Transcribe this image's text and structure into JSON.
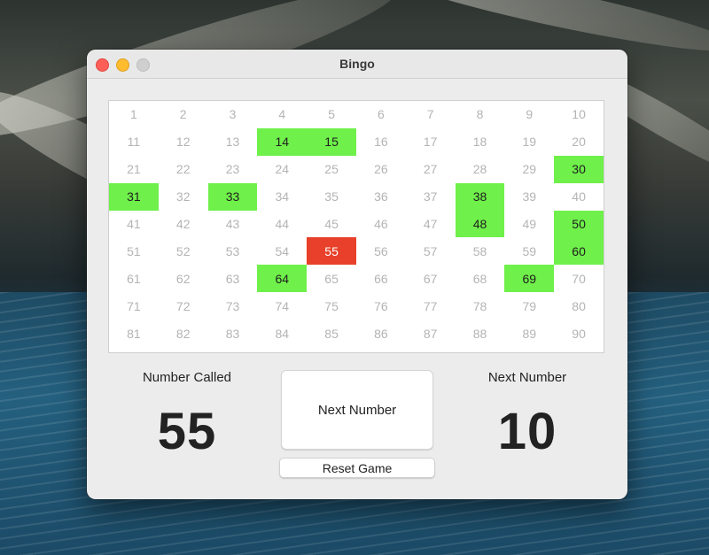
{
  "window": {
    "title": "Bingo"
  },
  "colors": {
    "called": "#6ff04a",
    "current": "#e8402a",
    "uncalled_text": "#b4b4b4"
  },
  "board": {
    "numbers": [
      1,
      2,
      3,
      4,
      5,
      6,
      7,
      8,
      9,
      10,
      11,
      12,
      13,
      14,
      15,
      16,
      17,
      18,
      19,
      20,
      21,
      22,
      23,
      24,
      25,
      26,
      27,
      28,
      29,
      30,
      31,
      32,
      33,
      34,
      35,
      36,
      37,
      38,
      39,
      40,
      41,
      42,
      43,
      44,
      45,
      46,
      47,
      48,
      49,
      50,
      51,
      52,
      53,
      54,
      55,
      56,
      57,
      58,
      59,
      60,
      61,
      62,
      63,
      64,
      65,
      66,
      67,
      68,
      69,
      70,
      71,
      72,
      73,
      74,
      75,
      76,
      77,
      78,
      79,
      80,
      81,
      82,
      83,
      84,
      85,
      86,
      87,
      88,
      89,
      90
    ],
    "called": [
      14,
      15,
      30,
      31,
      33,
      38,
      48,
      50,
      60,
      64,
      69
    ],
    "current": 55
  },
  "number_called": {
    "label": "Number Called",
    "value": "55"
  },
  "next_number": {
    "label": "Next Number",
    "value": "10"
  },
  "buttons": {
    "next_number": "Next Number",
    "reset_game": "Reset Game"
  }
}
